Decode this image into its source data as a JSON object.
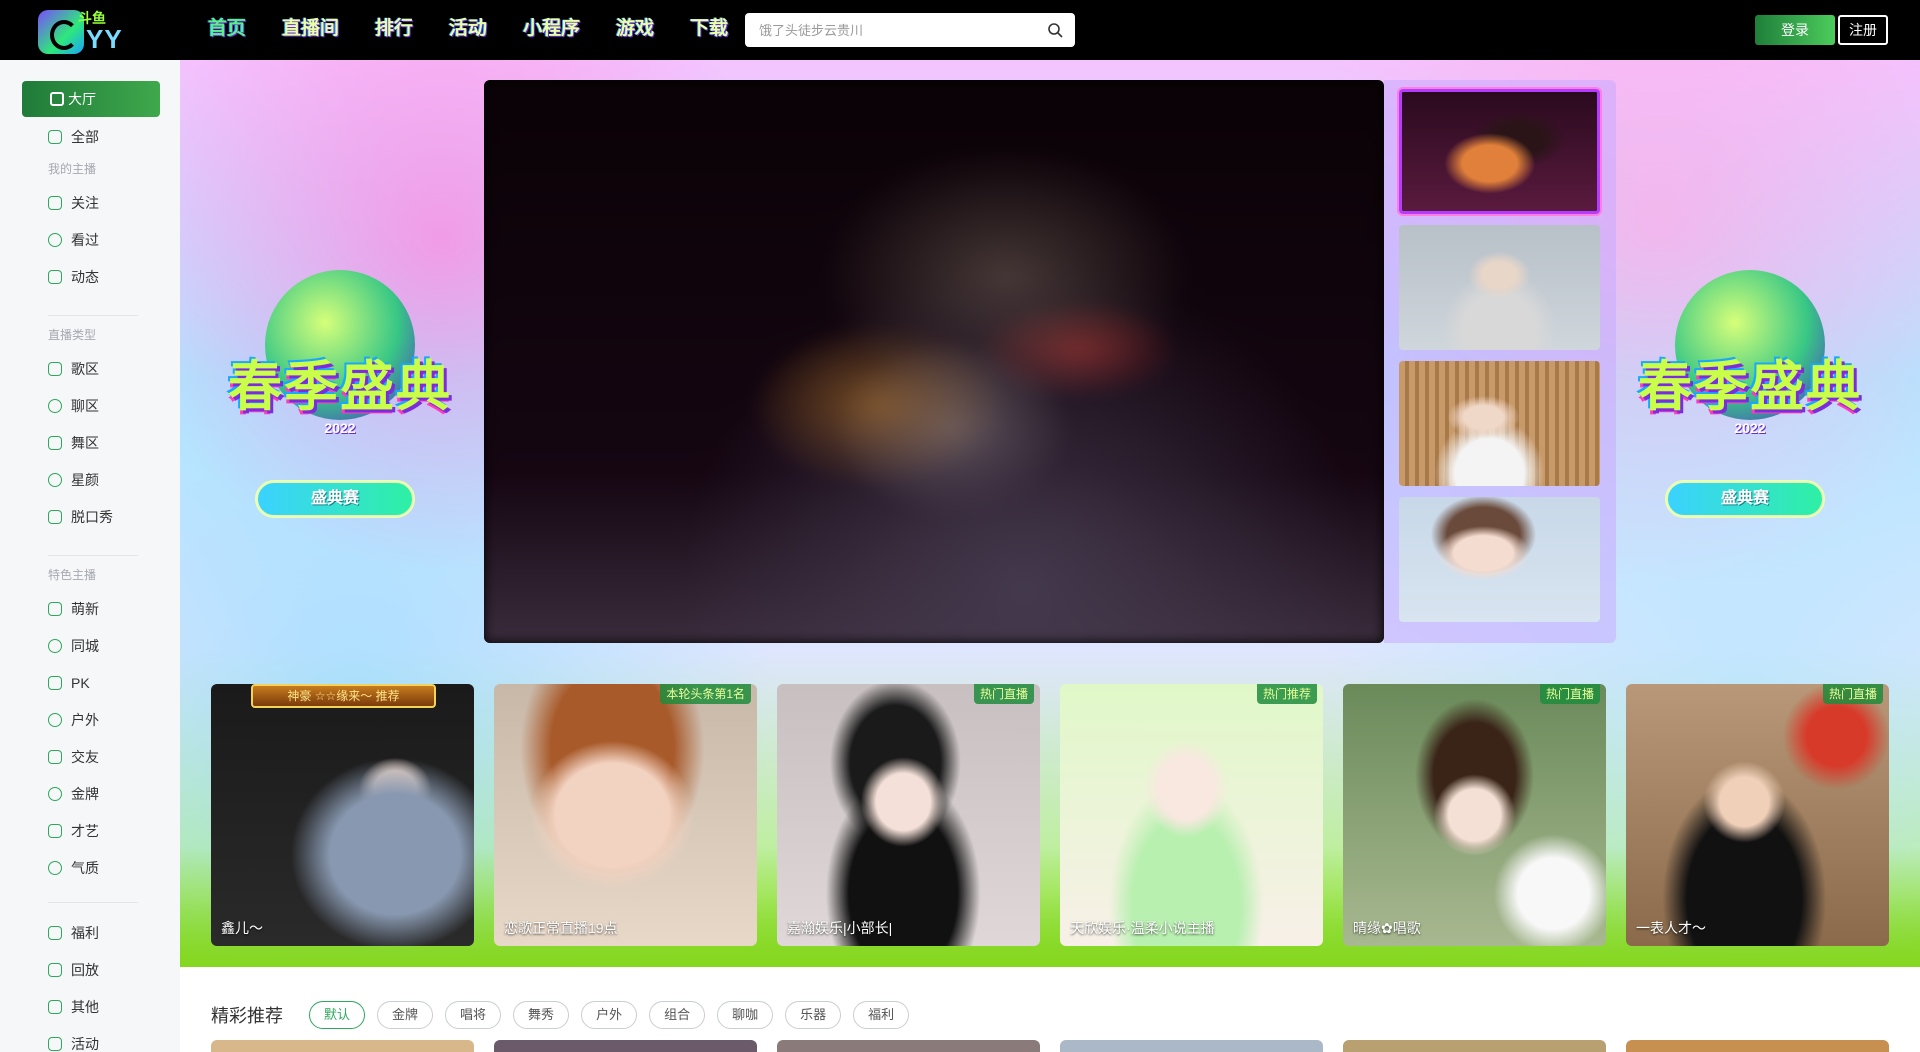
{
  "header": {
    "logo_text_top": "斗鱼",
    "logo_text": "YY",
    "nav": [
      {
        "label": "首页",
        "active": true
      },
      {
        "label": "直播间",
        "active": false
      },
      {
        "label": "排行",
        "active": false
      },
      {
        "label": "活动",
        "active": false
      },
      {
        "label": "小程序",
        "active": false
      },
      {
        "label": "游戏",
        "active": false
      },
      {
        "label": "下载",
        "active": false
      }
    ],
    "search_placeholder": "饿了头徒步云贵川",
    "login_label": "登录",
    "register_label": "注册"
  },
  "sidebar": {
    "hall_label": "大厅",
    "all_label": "全部",
    "sections": [
      {
        "title": "我的主播",
        "items": [
          {
            "label": "关注",
            "icon": "heart-icon"
          },
          {
            "label": "看过",
            "icon": "clock-icon"
          },
          {
            "label": "动态",
            "icon": "feed-icon"
          }
        ]
      },
      {
        "title": "直播类型",
        "items": [
          {
            "label": "歌区",
            "icon": "music-icon"
          },
          {
            "label": "聊区",
            "icon": "chat-icon"
          },
          {
            "label": "舞区",
            "icon": "dance-icon"
          },
          {
            "label": "星颜",
            "icon": "star-face-icon"
          },
          {
            "label": "脱口秀",
            "icon": "mic-icon"
          }
        ]
      },
      {
        "title": "特色主播",
        "items": [
          {
            "label": "萌新",
            "icon": "sprout-icon"
          },
          {
            "label": "同城",
            "icon": "location-icon"
          },
          {
            "label": "PK",
            "icon": "bolt-icon"
          },
          {
            "label": "户外",
            "icon": "mountain-icon"
          },
          {
            "label": "交友",
            "icon": "friends-icon"
          },
          {
            "label": "金牌",
            "icon": "medal-icon"
          },
          {
            "label": "才艺",
            "icon": "talent-icon"
          },
          {
            "label": "气质",
            "icon": "temperament-icon"
          }
        ]
      }
    ],
    "extra_items": [
      {
        "label": "福利",
        "icon": "gift-icon"
      },
      {
        "label": "回放",
        "icon": "replay-icon"
      },
      {
        "label": "其他",
        "icon": "more-icon"
      },
      {
        "label": "活动",
        "icon": "star-icon"
      }
    ]
  },
  "banner": {
    "festival_title": "春季盛典",
    "festival_year": "2022",
    "festival_button": "盛典赛",
    "cards": [
      {
        "name": "鑫儿～",
        "badge": "",
        "top_banner": "神豪 ☆☆缘来～ 推荐"
      },
      {
        "name": "恋歌正常直播19点",
        "badge": "本轮头条第1名",
        "top_banner": ""
      },
      {
        "name": "嘉瀚娱乐|小部长|",
        "badge": "热门直播",
        "top_banner": ""
      },
      {
        "name": "天欣娱乐·温柔小说主播",
        "badge": "热门推荐",
        "top_banner": ""
      },
      {
        "name": "晴缘✿唱歌",
        "badge": "热门直播",
        "top_banner": ""
      },
      {
        "name": "一表人才～",
        "badge": "热门直播",
        "top_banner": ""
      }
    ]
  },
  "recommend": {
    "title": "精彩推荐",
    "tabs": [
      {
        "label": "默认",
        "active": true
      },
      {
        "label": "金牌",
        "active": false
      },
      {
        "label": "唱将",
        "active": false
      },
      {
        "label": "舞秀",
        "active": false
      },
      {
        "label": "户外",
        "active": false
      },
      {
        "label": "组合",
        "active": false
      },
      {
        "label": "聊咖",
        "active": false
      },
      {
        "label": "乐器",
        "active": false
      },
      {
        "label": "福利",
        "active": false
      }
    ]
  },
  "colors": {
    "accent": "#2da85c",
    "header_bg": "#000000",
    "banner_green": "#86d71f"
  }
}
